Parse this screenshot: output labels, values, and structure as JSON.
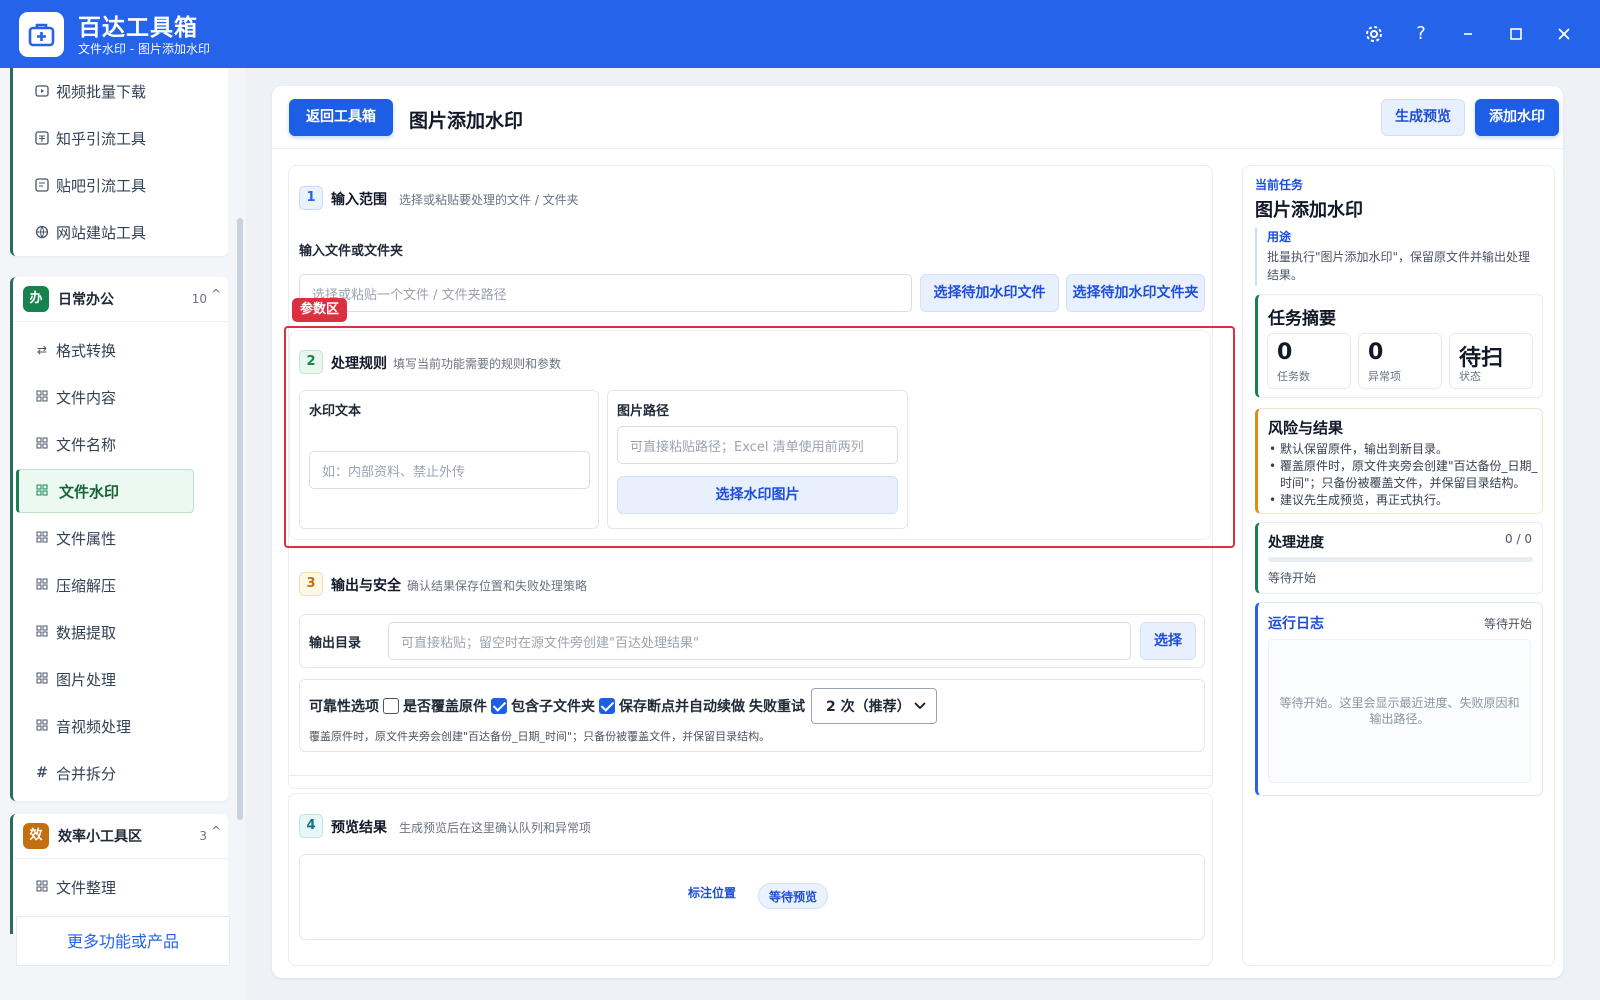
{
  "app": {
    "name": "百达工具箱",
    "subtitle": "文件水印 - 图片添加水印"
  },
  "window_controls": [
    "settings-icon",
    "help-icon",
    "minimize-icon",
    "maximize-icon",
    "close-icon"
  ],
  "window_labels": {
    "help": "?"
  },
  "sidebar": {
    "top_items": [
      {
        "label": "视频批量下载",
        "icon": "video-icon"
      },
      {
        "label": "知乎引流工具",
        "icon": "zhihu-icon"
      },
      {
        "label": "贴吧引流工具",
        "icon": "tieba-icon"
      },
      {
        "label": "网站建站工具",
        "icon": "website-icon"
      }
    ],
    "group_daily": {
      "badge": "办",
      "title": "日常办公",
      "count": "10",
      "caret": "^",
      "items": [
        {
          "label": "格式转换",
          "icon": "convert-icon"
        },
        {
          "label": "文件内容",
          "icon": "grid-icon"
        },
        {
          "label": "文件名称",
          "icon": "grid-icon"
        },
        {
          "label": "文件水印",
          "icon": "grid-icon",
          "active": true
        },
        {
          "label": "文件属性",
          "icon": "grid-icon"
        },
        {
          "label": "压缩解压",
          "icon": "grid-icon"
        },
        {
          "label": "数据提取",
          "icon": "grid-icon"
        },
        {
          "label": "图片处理",
          "icon": "grid-icon"
        },
        {
          "label": "音视频处理",
          "icon": "grid-icon"
        },
        {
          "label": "合并拆分",
          "icon": "hash-icon"
        }
      ]
    },
    "group_efficiency": {
      "badge": "效",
      "title": "效率小工具区",
      "count": "3",
      "caret": "^",
      "items": [
        {
          "label": "文件整理",
          "icon": "grid-icon"
        }
      ]
    },
    "more_link": "更多功能或产品"
  },
  "toolbar": {
    "back_label": "返回工具箱",
    "title": "图片添加水印",
    "preview_label": "生成预览",
    "run_label": "添加水印"
  },
  "steps": {
    "s1": {
      "num": "1",
      "title": "输入范围",
      "desc": "选择或粘贴要处理的文件 / 文件夹",
      "field_label": "输入文件或文件夹",
      "placeholder": "选择或粘贴一个文件 / 文件夹路径",
      "btn_file": "选择待加水印文件",
      "btn_folder": "选择待加水印文件夹"
    },
    "highlight_tag": "参数区",
    "s2": {
      "num": "2",
      "title": "处理规则",
      "desc": "填写当前功能需要的规则和参数",
      "text_label": "水印文本",
      "text_placeholder": "如：内部资料、禁止外传",
      "img_label": "图片路径",
      "img_placeholder": "可直接粘贴路径；Excel 清单使用前两列",
      "img_btn": "选择水印图片"
    },
    "s3": {
      "num": "3",
      "title": "输出与安全",
      "desc": "确认结果保存位置和失败处理策略",
      "out_label": "输出目录",
      "out_placeholder": "可直接粘贴；留空时在源文件旁创建\"百达处理结果\"",
      "out_btn": "选择",
      "reliability_label": "可靠性选项",
      "opt_overwrite": "是否覆盖原件",
      "opt_subfolders": "包含子文件夹",
      "opt_resume": "保存断点并自动续做",
      "retry_label": "失败重试",
      "retry_value": "2 次（推荐）",
      "note": "覆盖原件时，原文件夹旁会创建\"百达备份_日期_时间\"；只备份被覆盖文件，并保留目录结构。"
    },
    "s4": {
      "num": "4",
      "title": "预览结果",
      "desc": "生成预览后在这里确认队列和异常项",
      "mark_label": "标注位置",
      "status": "等待预览"
    }
  },
  "right_panel": {
    "current_label": "当前任务",
    "task_title": "图片添加水印",
    "purpose_label": "用途",
    "purpose_text": "批量执行\"图片添加水印\"，保留原文件并输出处理结果。",
    "summary_title": "任务摘要",
    "stats": [
      {
        "value": "0",
        "label": "任务数"
      },
      {
        "value": "0",
        "label": "异常项"
      },
      {
        "value": "待扫",
        "label": "状态"
      }
    ],
    "risk_title": "风险与结果",
    "risk_items": [
      "默认保留原件，输出到新目录。",
      "覆盖原件时，原文件夹旁会创建\"百达备份_日期_时间\"；只备份被覆盖文件，并保留目录结构。",
      "建议先生成预览，再正式执行。"
    ],
    "progress_title": "处理进度",
    "progress_count": "0 / 0",
    "progress_value": 0,
    "progress_status": "等待开始",
    "log_title": "运行日志",
    "log_status": "等待开始",
    "log_placeholder": "等待开始。这里会显示最近进度、失败原因和输出路径。"
  },
  "colors": {
    "titlebar": "#2563eb",
    "primary": "#1d5ee6",
    "active_green": "#17824e",
    "highlight_red": "#dc2f3f",
    "badge_daily": "#17824e",
    "badge_efficiency": "#c2700f"
  }
}
